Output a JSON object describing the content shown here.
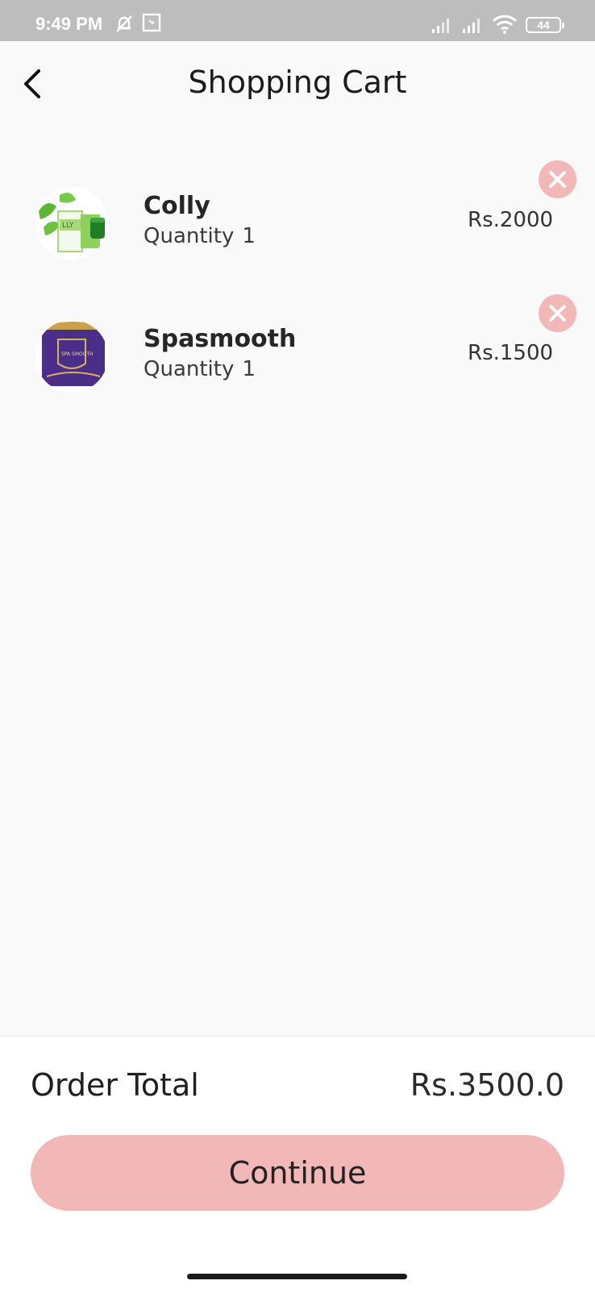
{
  "status_bar": {
    "time": "9:49 PM",
    "battery": "44",
    "icons": [
      "mute-icon",
      "app-notification-icon",
      "signal-icon",
      "signal-icon",
      "wifi-icon",
      "battery-icon"
    ]
  },
  "header": {
    "title": "Shopping Cart",
    "back_icon": "chevron-left-icon"
  },
  "cart": {
    "quantity_label": "Quantity",
    "items": [
      {
        "name": "Colly",
        "quantity": "1",
        "price": "Rs.2000",
        "thumb_colors": [
          "#5cb82e",
          "#9fd46a",
          "#ffffff"
        ]
      },
      {
        "name": "Spasmooth",
        "quantity": "1",
        "price": "Rs.1500",
        "thumb_colors": [
          "#4b2d8a",
          "#c9a24a",
          "#ffffff"
        ]
      }
    ],
    "remove_icon": "close-icon"
  },
  "footer": {
    "total_label": "Order Total",
    "total_value": "Rs.3500.0",
    "continue_label": "Continue"
  },
  "colors": {
    "accent": "#f2b8b8",
    "status_bar": "#bdbdbd",
    "background": "#f9f9f9"
  }
}
